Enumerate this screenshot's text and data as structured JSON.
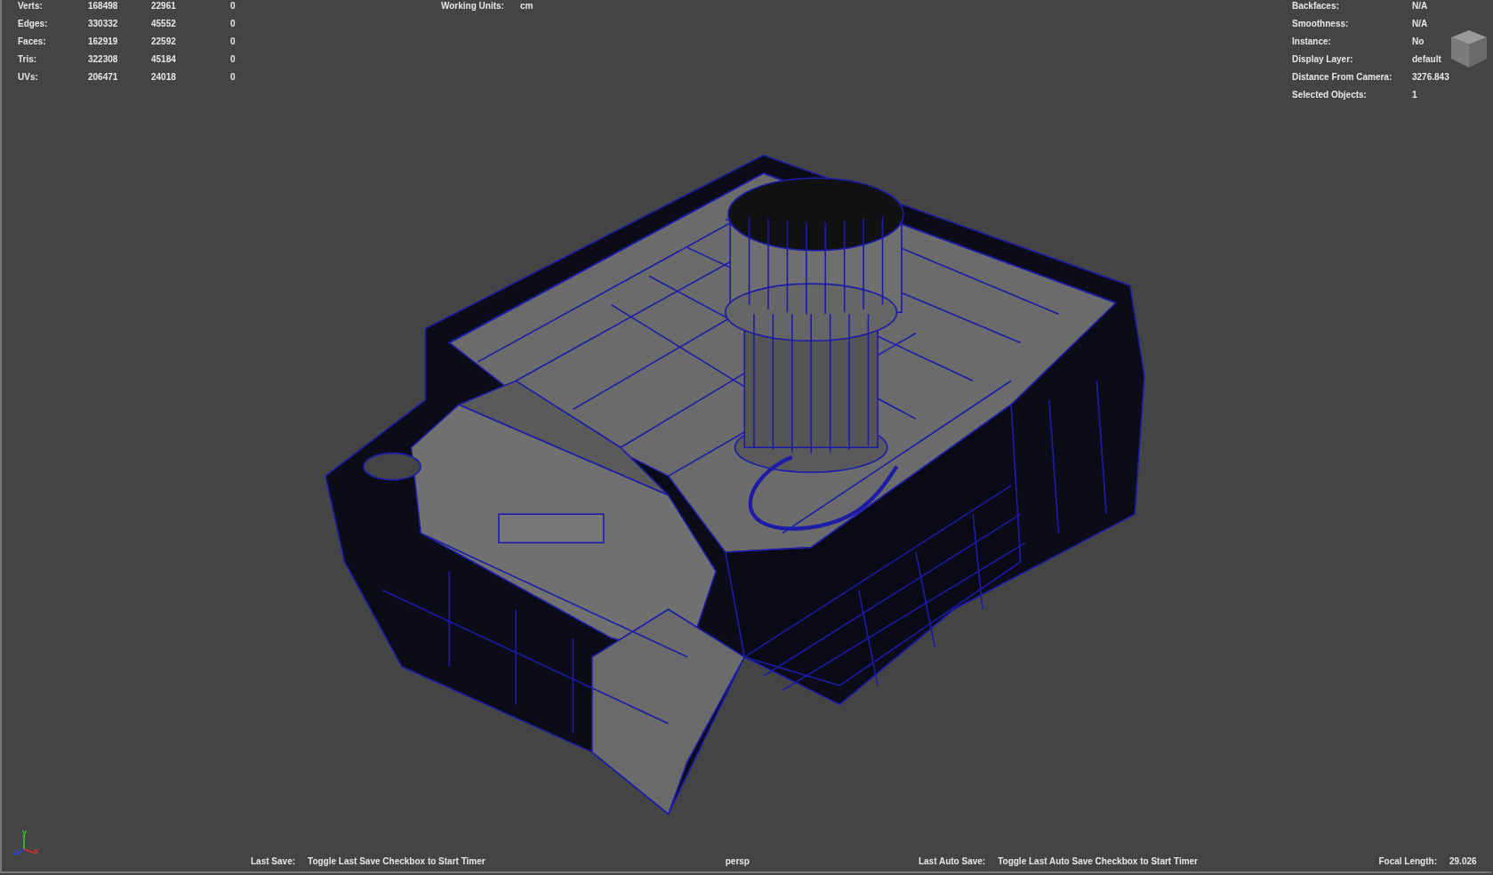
{
  "poly_stats": [
    {
      "label": "Verts:",
      "values": [
        "168498",
        "22961",
        "0"
      ]
    },
    {
      "label": "Edges:",
      "values": [
        "330332",
        "45552",
        "0"
      ]
    },
    {
      "label": "Faces:",
      "values": [
        "162919",
        "22592",
        "0"
      ]
    },
    {
      "label": "Tris:",
      "values": [
        "322308",
        "45184",
        "0"
      ]
    },
    {
      "label": "UVs:",
      "values": [
        "206471",
        "24018",
        "0"
      ]
    }
  ],
  "working_units": {
    "label": "Working Units:",
    "value": "cm"
  },
  "object_details": [
    {
      "label": "Backfaces:",
      "value": "N/A"
    },
    {
      "label": "Smoothness:",
      "value": "N/A"
    },
    {
      "label": "Instance:",
      "value": "No"
    },
    {
      "label": "Display Layer:",
      "value": "default"
    },
    {
      "label": "Distance From Camera:",
      "value": "3276.843"
    },
    {
      "label": "Selected Objects:",
      "value": "1"
    }
  ],
  "axis_labels": {
    "x": "x",
    "y": "y",
    "z": "z"
  },
  "status_bar": {
    "last_save_label": "Last Save:",
    "last_save_value": "Toggle Last Save Checkbox to Start Timer",
    "camera": "persp",
    "last_auto_save_label": "Last Auto Save:",
    "last_auto_save_value": "Toggle Last Auto Save Checkbox to Start Timer",
    "focal_length_label": "Focal Length:",
    "focal_length_value": "29.026"
  }
}
